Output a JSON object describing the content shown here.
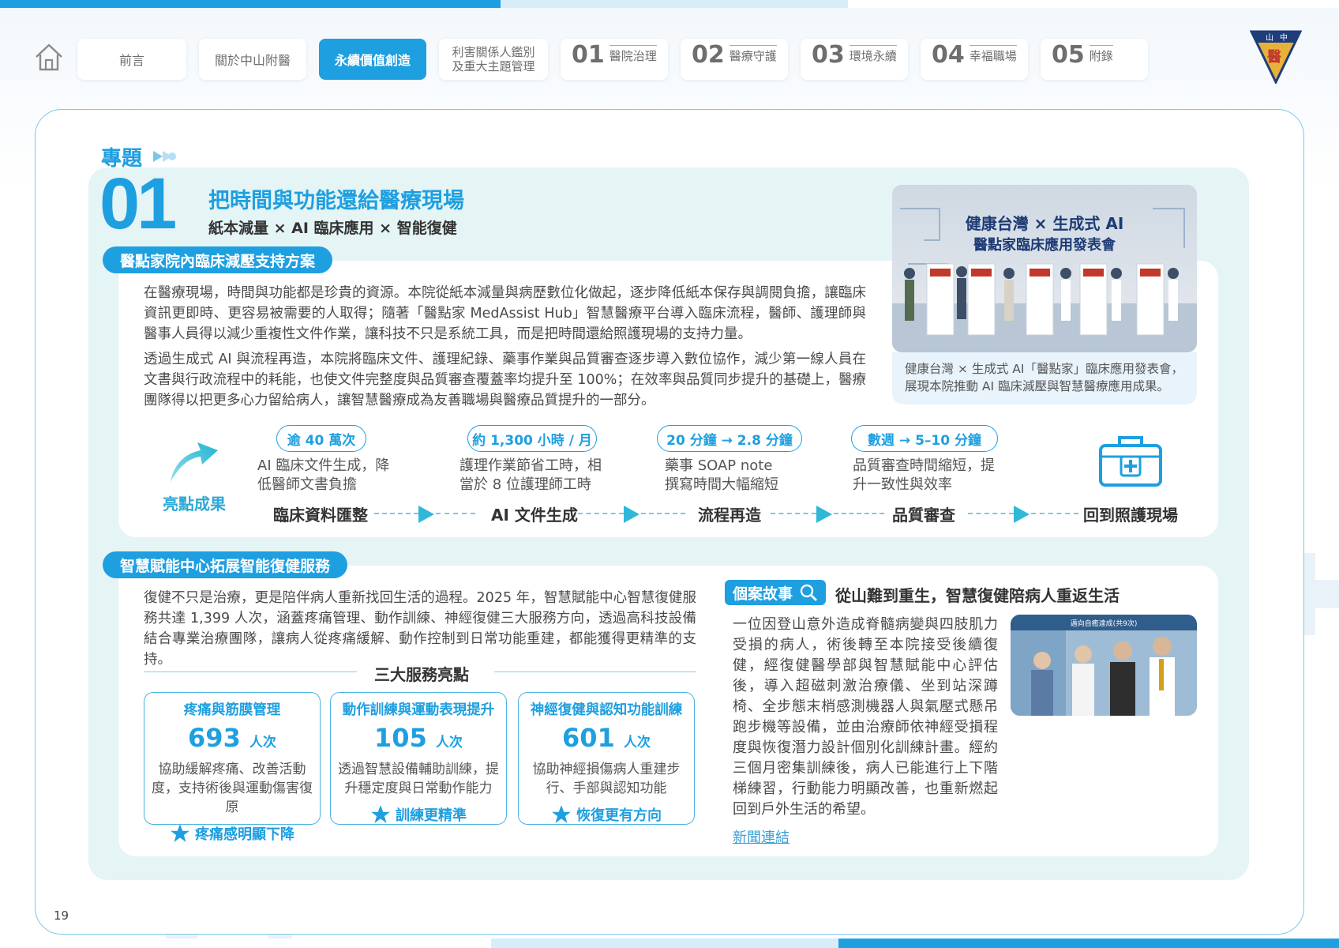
{
  "nav": {
    "items": [
      "前言",
      "關於中山附醫",
      "永續價值創造"
    ],
    "two_line": [
      "利害關係人鑑別",
      "及重大主題管理"
    ],
    "chapters": [
      {
        "num": "01",
        "label": "醫院治理"
      },
      {
        "num": "02",
        "label": "醫療守護"
      },
      {
        "num": "03",
        "label": "環境永續"
      },
      {
        "num": "04",
        "label": "幸福職場"
      },
      {
        "num": "05",
        "label": "附錄"
      }
    ],
    "logo_text": [
      "山",
      "中",
      "醫"
    ]
  },
  "topic": {
    "label": "專題",
    "number": "01",
    "title": "把時間與功能還給醫療現場",
    "subtitle": "紙本減量 × AI 臨床應用 × 智能復健"
  },
  "section1": {
    "pill": "醫點家院內臨床減壓支持方案",
    "para1": "在醫療現場，時間與功能都是珍貴的資源。本院從紙本減量與病歷數位化做起，逐步降低紙本保存與調閱負擔，讓臨床資訊更即時、更容易被需要的人取得；隨著「醫點家 MedAssist Hub」智慧醫療平台導入臨床流程，醫師、護理師與醫事人員得以減少重複性文件作業，讓科技不只是系統工具，而是把時間還給照護現場的支持力量。",
    "para2": "透過生成式 AI 與流程再造，本院將臨床文件、護理紀錄、藥事作業與品質審查逐步導入數位協作，減少第一線人員在文書與行政流程中的耗能，也使文件完整度與品質審查覆蓋率均提升至 100%；在效率與品質同步提升的基礎上，醫療團隊得以把更多心力留給病人，讓智慧醫療成為友善職場與醫療品質提升的一部分。",
    "photo": {
      "banner_line1": "健康台灣 × 生成式 AI",
      "banner_line2": "醫點家臨床應用發表會",
      "caption": "健康台灣 × 生成式 AI「醫點家」臨床應用發表會，展現本院推動 AI 臨床減壓與智慧醫療應用成果。"
    },
    "highlights_label": "亮點成果",
    "highlights": [
      {
        "pill": "逾 40 萬次",
        "desc": "AI 臨床文件生成，降低醫師文書負擔"
      },
      {
        "pill": "約 1,300 小時 / 月",
        "desc": "護理作業節省工時，相當於 8 位護理師工時"
      },
      {
        "pill": "20 分鐘 → 2.8 分鐘",
        "desc": "藥事 SOAP note 撰寫時間大幅縮短"
      },
      {
        "pill": "數週 → 5–10 分鐘",
        "desc": "品質審查時間縮短，提升一致性與效率"
      }
    ],
    "flow": [
      "臨床資料匯整",
      "AI 文件生成",
      "流程再造",
      "品質審查",
      "回到照護現場"
    ]
  },
  "section2": {
    "pill": "智慧賦能中心拓展智能復健服務",
    "para": "復健不只是治療，更是陪伴病人重新找回生活的過程。2025 年，智慧賦能中心智慧復健服務共達 1,399 人次，涵蓋疼痛管理、動作訓練、神經復健三大服務方向，透過高科技設備結合專業治療團隊，讓病人從疼痛緩解、動作控制到日常功能重建，都能獲得更精準的支持。",
    "services_title": "三大服務亮點",
    "unit": "人次",
    "cards": [
      {
        "title": "疼痛與筋膜管理",
        "value": "693",
        "desc": "協助緩解疼痛、改善活動度，支持術後與運動傷害復原",
        "footer": "疼痛感明顯下降"
      },
      {
        "title": "動作訓練與運動表現提升",
        "value": "105",
        "desc": "透過智慧設備輔助訓練，提升穩定度與日常動作能力",
        "footer": "訓練更精準"
      },
      {
        "title": "神經復健與認知功能訓練",
        "value": "601",
        "desc": "協助神經損傷病人重建步行、手部與認知功能",
        "footer": "恢復更有方向"
      }
    ],
    "case": {
      "tag": "個案故事",
      "title": "從山難到重生，智慧復健陪病人重返生活",
      "text": "一位因登山意外造成脊髓病變與四肢肌力受損的病人，術後轉至本院接受後續復健，經復健醫學部與智慧賦能中心評估後，導入超磁刺激治療儀、坐到站深蹲椅、全步態末梢感測機器人與氣壓式懸吊跑步機等設備，並由治療師依神經受損程度與恢復潛力設計個別化訓練計畫。經約三個月密集訓練後，病人已能進行上下階梯練習，行動能力明顯改善，也重新燃起回到戶外生活的希望。",
      "link": "新聞連結",
      "photo_banner": "邁向自癒達成(共9次)"
    }
  },
  "page_number": "19",
  "colors": {
    "accent": "#1e9fe0",
    "teal_bg": "#e5f4f5",
    "arrow": "#2fb8d8"
  }
}
